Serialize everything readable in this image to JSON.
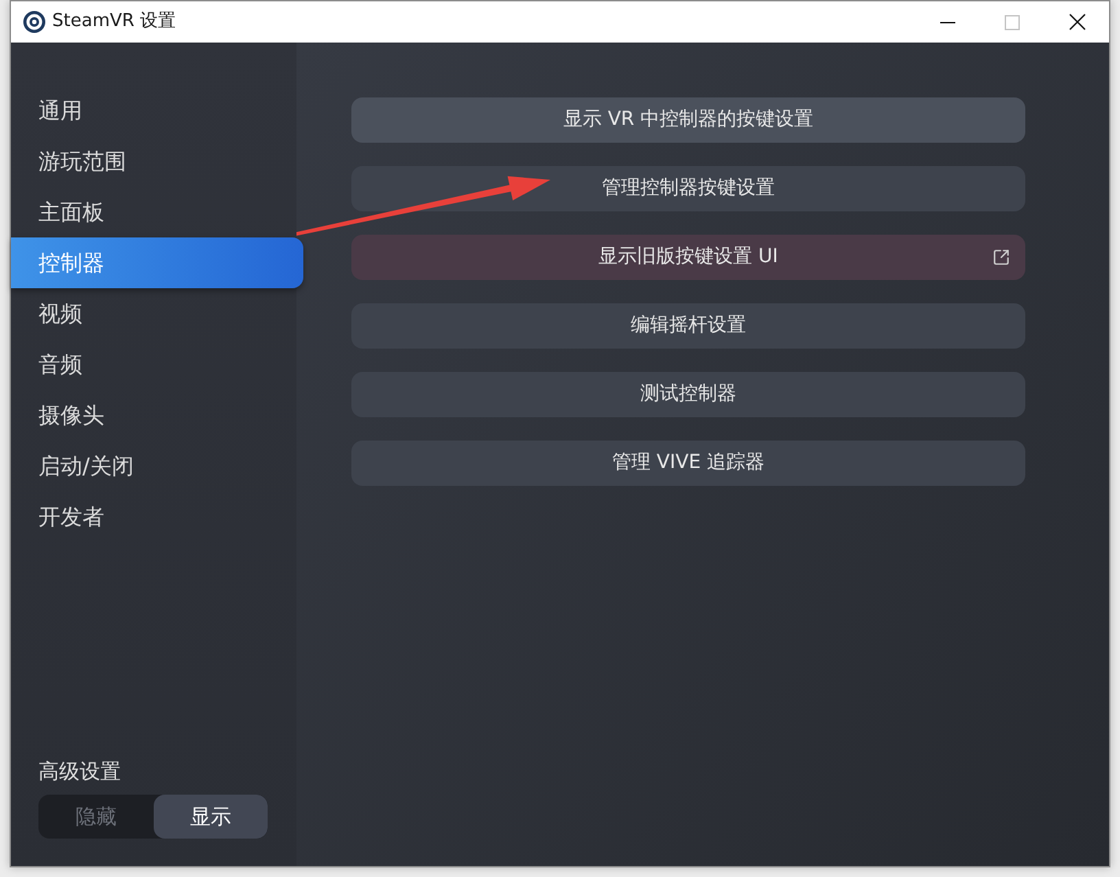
{
  "window": {
    "title": "SteamVR 设置",
    "controls": [
      {
        "kind": "minimize",
        "disabled": false
      },
      {
        "kind": "maximize",
        "disabled": true
      },
      {
        "kind": "close",
        "disabled": false
      }
    ]
  },
  "sidebar": {
    "items": [
      {
        "label": "通用",
        "selected": false
      },
      {
        "label": "游玩范围",
        "selected": false
      },
      {
        "label": "主面板",
        "selected": false
      },
      {
        "label": "控制器",
        "selected": true
      },
      {
        "label": "视频",
        "selected": false
      },
      {
        "label": "音频",
        "selected": false
      },
      {
        "label": "摄像头",
        "selected": false
      },
      {
        "label": "启动/关闭",
        "selected": false
      },
      {
        "label": "开发者",
        "selected": false
      }
    ],
    "advanced": {
      "label": "高级设置",
      "options": [
        {
          "label": "隐藏",
          "selected": false
        },
        {
          "label": "显示",
          "selected": true
        }
      ]
    }
  },
  "buttons": [
    {
      "label": "显示 VR 中控制器的按键设置",
      "kind": "highlighted"
    },
    {
      "label": "管理控制器按键设置",
      "kind": "normal"
    },
    {
      "label": "显示旧版按键设置 UI",
      "kind": "external"
    },
    {
      "label": "编辑摇杆设置",
      "kind": "normal"
    },
    {
      "label": "测试控制器",
      "kind": "normal"
    },
    {
      "label": "管理 VIVE 追踪器",
      "kind": "normal"
    }
  ]
}
